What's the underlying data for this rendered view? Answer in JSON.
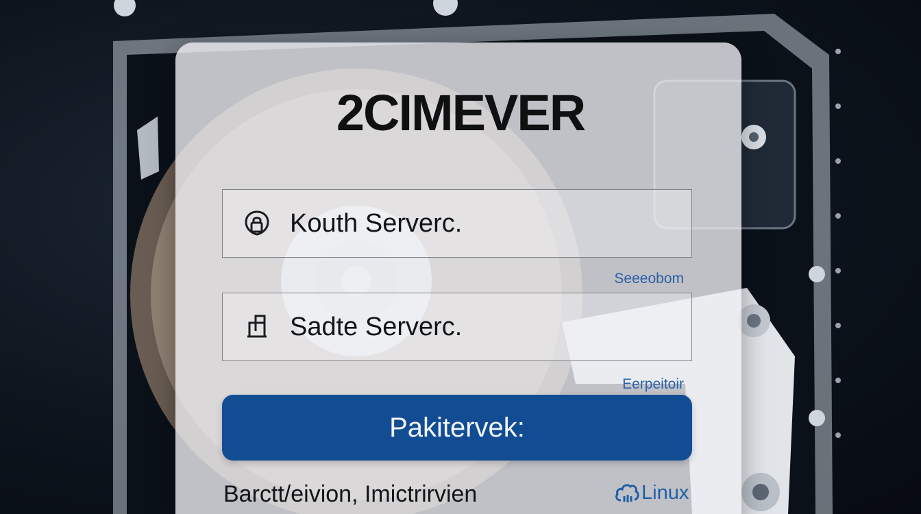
{
  "brand": {
    "title": "2CIMEVER"
  },
  "form": {
    "field1": {
      "icon": "lock-shield-icon",
      "value": "Kouth Serverc."
    },
    "field1_hint": "Seeeobom",
    "field2": {
      "icon": "door-icon",
      "value": "Sadte Serverc."
    },
    "field2_hint": "Eerpeitoir",
    "submit_label": "Pakitervek:"
  },
  "footer": {
    "text": "Barctt/eivion, Imictrirvien",
    "badge_label": "Linux",
    "badge_icon": "cloud-icon"
  },
  "colors": {
    "primary": "#124d94",
    "link": "#2a5fa8",
    "card": "#eceef1"
  }
}
